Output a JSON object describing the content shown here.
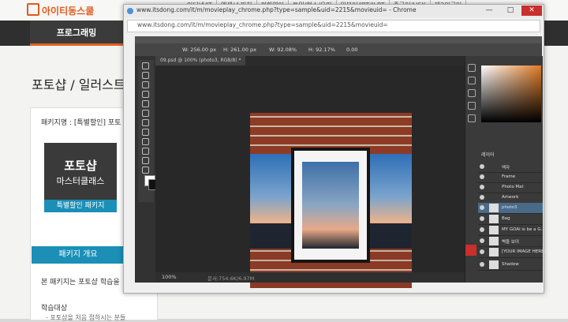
{
  "site": {
    "logo_text": "아이티동스쿨",
    "top_nav": [
      "인터넷/IT",
      "엑셀/스피치",
      "전화영어",
      "토익/협스/오픽",
      "일본어/JPT/JLPT",
      "중국어/HSK",
      "제3외국어"
    ],
    "menu_tab": "프로그래밍",
    "page_title": "포토샵 / 일러스트",
    "package_name": "패키지명 : [특별할인] 포토",
    "book_title_1": "포토샵",
    "book_title_2": "마스터클래스",
    "book_band": "특별할인 패키지",
    "overview_label": "패키지 개요",
    "intro_text": "본 패키지는 포토샵 학습을",
    "learn_title": "학습대상",
    "learn_sub": "- 포토샵을 처음 접하시는 분들"
  },
  "window": {
    "title": "www.itsdong.com/it/m/movieplay_chrome.php?type=sample&uid=2215&movieuid= - Chrome",
    "url": "www.itsdong.com/it/m/movieplay_chrome.php?type=sample&uid=2215&movieuid=",
    "btn_min": "—",
    "btn_max": "□",
    "btn_close": "✕"
  },
  "photoshop": {
    "options": [
      "W: 256.00 px",
      "H: 261.00 px",
      "W: 92.08%",
      "H: 92.17%",
      "0.00"
    ],
    "doc_tab": "09.psd @ 100% (photo3, RGB/8) *",
    "zoom": "100%",
    "doc_info": "문서:754.6K/6.97M",
    "layers_tab": "레이어",
    "layers": [
      {
        "name": "액자"
      },
      {
        "name": "Frame"
      },
      {
        "name": "Photo Mat"
      },
      {
        "name": "Artwork"
      },
      {
        "name": "photo3"
      },
      {
        "name": "Bag"
      },
      {
        "name": "MY GOAl is be a G..."
      },
      {
        "name": "벽돌 보이"
      },
      {
        "name": "[YOUR IMAGE HERE]"
      },
      {
        "name": "Shadow"
      }
    ]
  }
}
